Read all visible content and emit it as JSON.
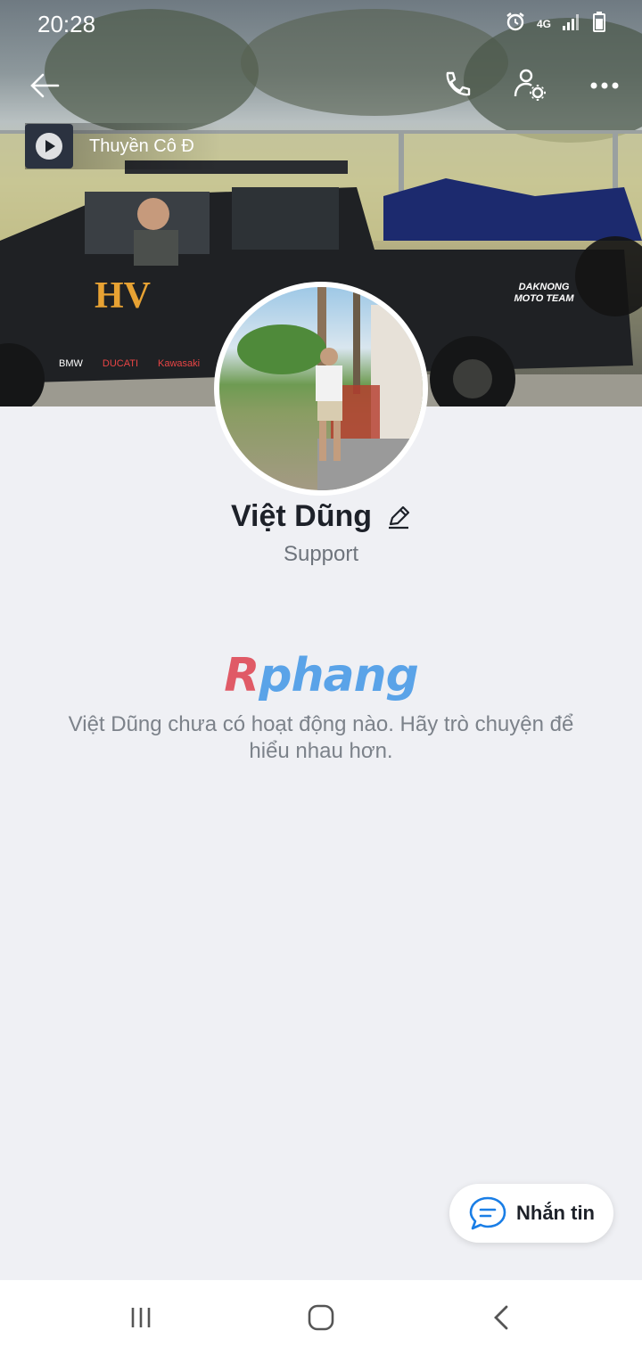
{
  "status_bar": {
    "time": "20:28",
    "network": "4G"
  },
  "header": {
    "back_icon": "back-arrow-icon",
    "call_icon": "phone-icon",
    "settings_icon": "user-settings-icon",
    "more_icon": "more-icon"
  },
  "music": {
    "title": "Thuyền Cô Đ"
  },
  "cover_decals": {
    "logo": "HV",
    "brands": [
      "BMW",
      "DUCATI",
      "Kawasaki"
    ],
    "team": "DAKNONG MOTO TEAM"
  },
  "profile": {
    "name": "Việt Dũng",
    "subtitle": "Support"
  },
  "watermark": {
    "first": "R",
    "rest": "phang"
  },
  "empty_state": {
    "text": "Việt Dũng chưa có hoạt động nào. Hãy trò chuyện để hiểu nhau hơn."
  },
  "message_button": {
    "label": "Nhắn tin"
  },
  "colors": {
    "accent": "#1a7ee6",
    "background": "#eff0f4"
  }
}
